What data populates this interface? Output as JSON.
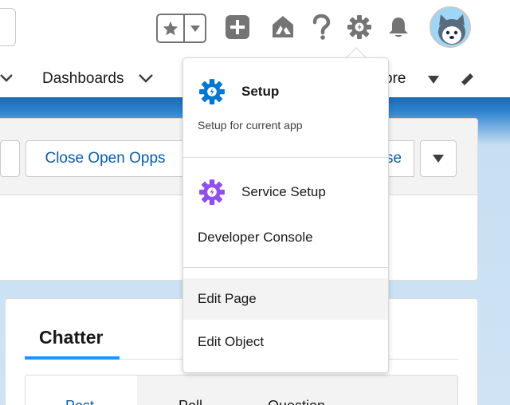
{
  "header": {
    "favorites_star_icon": "star-icon",
    "favorites_menu_icon": "caret-down-icon",
    "icons": [
      "global-actions-add-icon",
      "trailhead-icon",
      "help-icon",
      "setup-gear-icon",
      "notifications-bell-icon"
    ],
    "avatar_icon": "user-avatar-icon"
  },
  "nav": {
    "dashboards_label": "Dashboards",
    "more_label": "ore",
    "edit_icon": "pencil-icon"
  },
  "page": {
    "action_close_opps": "Close Open Opps",
    "action_truncated": "se",
    "chatter_title": "Chatter",
    "publisher_tabs": [
      "Post",
      "Poll",
      "Question"
    ]
  },
  "setup_menu": {
    "setup_title": "Setup",
    "setup_subtitle": "Setup for current app",
    "service_setup": "Service Setup",
    "developer_console": "Developer Console",
    "edit_page": "Edit Page",
    "edit_object": "Edit Object"
  },
  "colors": {
    "link_blue": "#0b5cab",
    "setup_gear_blue": "#0176d3",
    "service_gear_purple": "#9050e9",
    "band_blue": "#2f84d0"
  }
}
